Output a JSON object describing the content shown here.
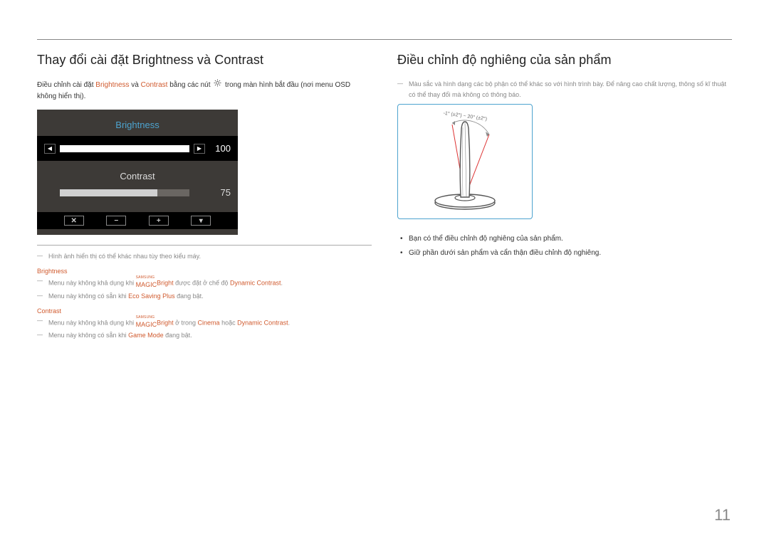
{
  "page_number": "11",
  "left": {
    "heading": "Thay đổi cài đặt Brightness và Contrast",
    "intro_a": "Điều chỉnh cài đặt ",
    "intro_brightness": "Brightness",
    "intro_and": " và ",
    "intro_contrast": "Contrast",
    "intro_b": " bằng các nút ",
    "intro_c": " trong màn hình bắt đầu (nơi menu OSD không hiển thị).",
    "osd": {
      "brightness_label": "Brightness",
      "brightness_value": "100",
      "contrast_label": "Contrast",
      "contrast_value": "75",
      "buttons": [
        "✕",
        "−",
        "+",
        "▾"
      ]
    },
    "note_image": "Hình ảnh hiển thị có thể khác nhau tùy theo kiểu máy.",
    "brightness_section": {
      "label": "Brightness",
      "note1_a": "Menu này không khả dụng khi ",
      "note1_magic_small": "SAMSUNG",
      "note1_magic_main": "MAGIC",
      "note1_bright": "Bright",
      "note1_b": " được đặt ở chế độ ",
      "note1_dc": "Dynamic Contrast",
      "note1_c": ".",
      "note2_a": "Menu này không có sẵn khi ",
      "note2_eco": "Eco Saving Plus",
      "note2_b": " đang bật."
    },
    "contrast_section": {
      "label": "Contrast",
      "note1_a": "Menu này không khả dụng khi ",
      "note1_magic_small": "SAMSUNG",
      "note1_magic_main": "MAGIC",
      "note1_bright": "Bright",
      "note1_b": " ở trong ",
      "note1_cinema": "Cinema",
      "note1_or": " hoặc ",
      "note1_dc": "Dynamic Contrast",
      "note1_c": ".",
      "note2_a": "Menu này không có sẵn khi ",
      "note2_gm": "Game Mode",
      "note2_b": " đang bật."
    }
  },
  "right": {
    "heading": "Điều chỉnh độ nghiêng của sản phẩm",
    "note_a": "Màu sắc và hình dạng các bộ phận có thể khác so với hình trình bày. Để nâng cao chất lượng, thông số kĩ thuật có thể thay đổi mà không có thông báo.",
    "tilt_label": "-1° (±2°) ~ 20° (±2°)",
    "bullets": [
      "Bạn có thể điều chỉnh độ nghiêng của sản phẩm.",
      "Giữ phần dưới sản phẩm và cẩn thận điều chỉnh độ nghiêng."
    ]
  }
}
